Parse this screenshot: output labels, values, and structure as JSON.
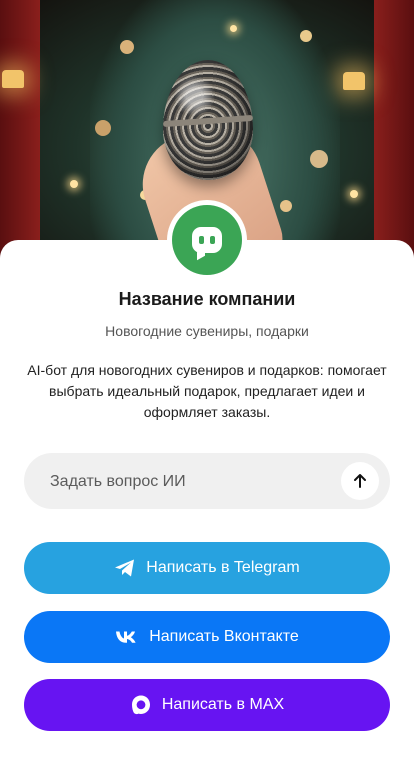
{
  "hero": {
    "image_alt_icon": "decorated-egg-over-christmas-tree-photo"
  },
  "avatar": {
    "icon": "chat-bot-icon",
    "color": "#3ba555"
  },
  "company": {
    "name": "Название компании",
    "subtitle": "Новогодние сувениры, подарки",
    "description": "AI-бот для новогодних сувениров и подарков: помогает выбрать идеальный подарок, предлагает идеи и оформляет заказы."
  },
  "ask": {
    "placeholder": "Задать вопрос ИИ",
    "value": "",
    "send_icon": "arrow-up-icon"
  },
  "buttons": {
    "telegram": {
      "label": "Написать в Telegram",
      "icon": "telegram-icon",
      "color": "#27a2e0"
    },
    "vk": {
      "label": "Написать Вконтакте",
      "icon": "vk-icon",
      "color": "#0a77f6"
    },
    "max": {
      "label": "Написать в MAX",
      "icon": "max-icon",
      "color": "#6714f2"
    }
  }
}
